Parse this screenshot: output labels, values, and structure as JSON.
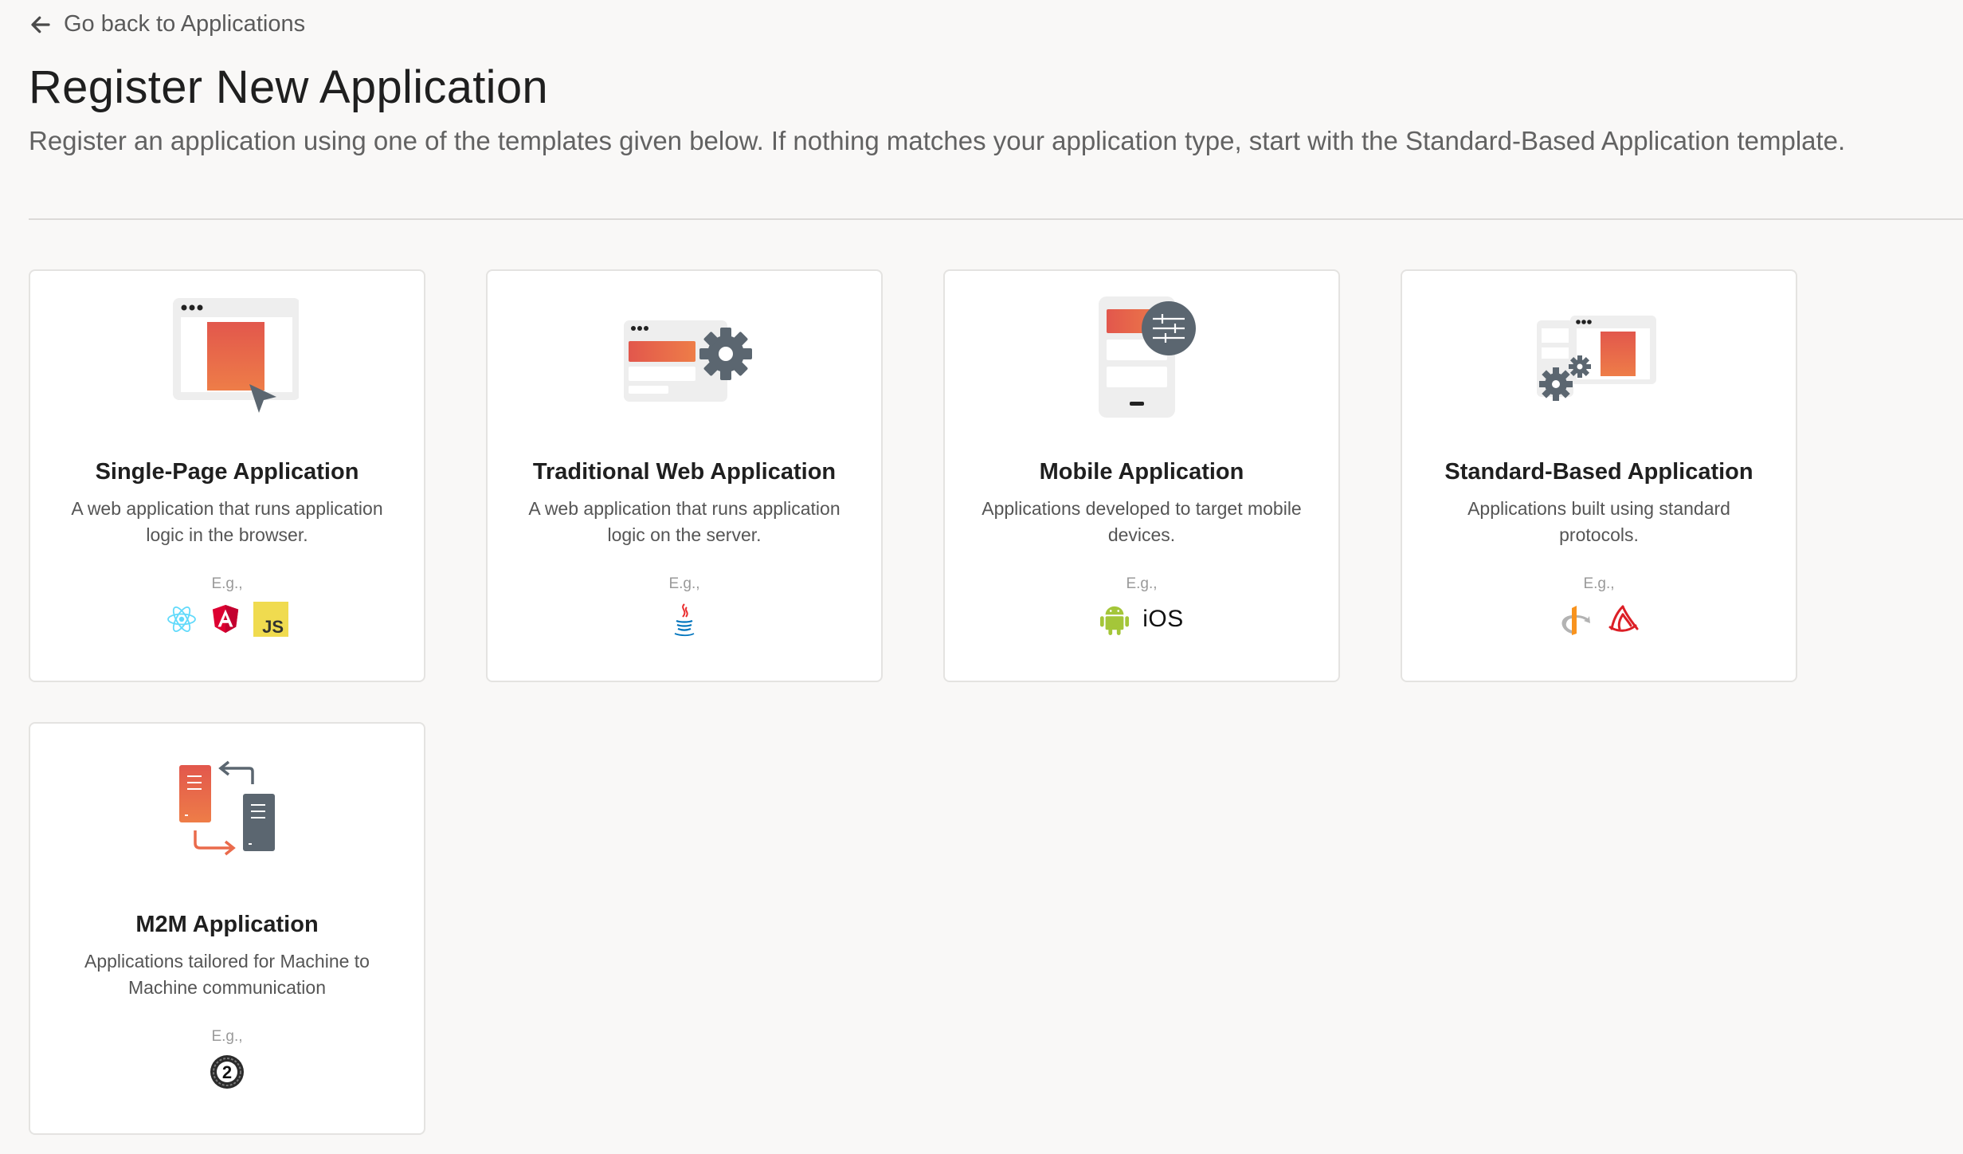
{
  "nav": {
    "back_label": "Go back to Applications"
  },
  "header": {
    "title": "Register New Application",
    "description": "Register an application using one of the templates given below. If nothing matches your application type, start with the Standard-Based Application template."
  },
  "colors": {
    "accent": "#ea6b4c",
    "icon_gray": "#5b6670",
    "background": "#f9f8f7"
  },
  "templates": [
    {
      "title": "Single-Page Application",
      "description": "A web application that runs application logic in the browser.",
      "examples_label": "E.g.,",
      "examples": [
        "react-icon",
        "angular-icon",
        "javascript-icon"
      ],
      "example_text": "JS"
    },
    {
      "title": "Traditional Web Application",
      "description": "A web application that runs application logic on the server.",
      "examples_label": "E.g.,",
      "examples": [
        "java-icon"
      ]
    },
    {
      "title": "Mobile Application",
      "description": "Applications developed to target mobile devices.",
      "examples_label": "E.g.,",
      "examples": [
        "android-icon",
        "ios-label"
      ],
      "example_text": "iOS"
    },
    {
      "title": "Standard-Based Application",
      "description": "Applications built using standard protocols.",
      "examples_label": "E.g.,",
      "examples": [
        "openid-icon",
        "saml-icon"
      ]
    },
    {
      "title": "M2M Application",
      "description": "Applications tailored for Machine to Machine communication",
      "examples_label": "E.g.,",
      "examples": [
        "oauth2-icon"
      ],
      "example_text": "2"
    }
  ]
}
